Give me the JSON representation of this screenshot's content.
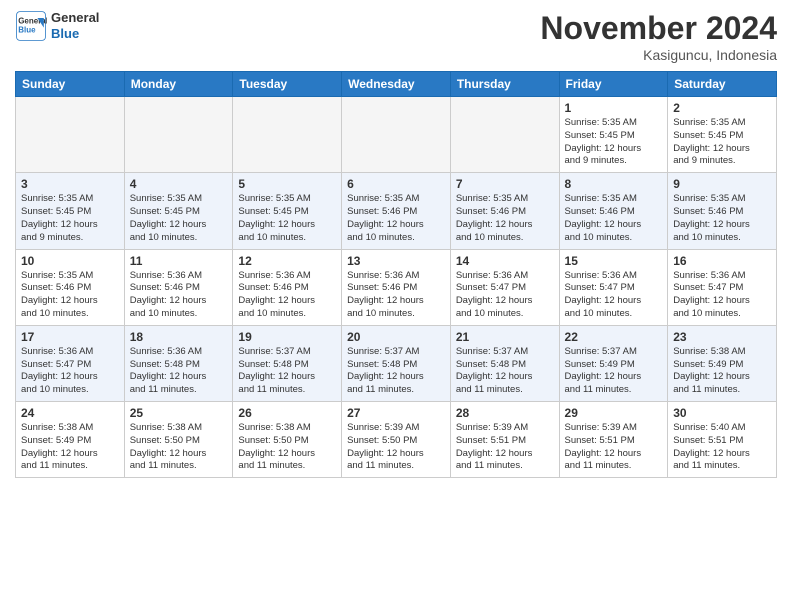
{
  "header": {
    "logo_line1": "General",
    "logo_line2": "Blue",
    "month": "November 2024",
    "location": "Kasiguncu, Indonesia"
  },
  "days_of_week": [
    "Sunday",
    "Monday",
    "Tuesday",
    "Wednesday",
    "Thursday",
    "Friday",
    "Saturday"
  ],
  "weeks": [
    [
      {
        "day": "",
        "info": ""
      },
      {
        "day": "",
        "info": ""
      },
      {
        "day": "",
        "info": ""
      },
      {
        "day": "",
        "info": ""
      },
      {
        "day": "",
        "info": ""
      },
      {
        "day": "1",
        "info": "Sunrise: 5:35 AM\nSunset: 5:45 PM\nDaylight: 12 hours\nand 9 minutes."
      },
      {
        "day": "2",
        "info": "Sunrise: 5:35 AM\nSunset: 5:45 PM\nDaylight: 12 hours\nand 9 minutes."
      }
    ],
    [
      {
        "day": "3",
        "info": "Sunrise: 5:35 AM\nSunset: 5:45 PM\nDaylight: 12 hours\nand 9 minutes."
      },
      {
        "day": "4",
        "info": "Sunrise: 5:35 AM\nSunset: 5:45 PM\nDaylight: 12 hours\nand 10 minutes."
      },
      {
        "day": "5",
        "info": "Sunrise: 5:35 AM\nSunset: 5:45 PM\nDaylight: 12 hours\nand 10 minutes."
      },
      {
        "day": "6",
        "info": "Sunrise: 5:35 AM\nSunset: 5:46 PM\nDaylight: 12 hours\nand 10 minutes."
      },
      {
        "day": "7",
        "info": "Sunrise: 5:35 AM\nSunset: 5:46 PM\nDaylight: 12 hours\nand 10 minutes."
      },
      {
        "day": "8",
        "info": "Sunrise: 5:35 AM\nSunset: 5:46 PM\nDaylight: 12 hours\nand 10 minutes."
      },
      {
        "day": "9",
        "info": "Sunrise: 5:35 AM\nSunset: 5:46 PM\nDaylight: 12 hours\nand 10 minutes."
      }
    ],
    [
      {
        "day": "10",
        "info": "Sunrise: 5:35 AM\nSunset: 5:46 PM\nDaylight: 12 hours\nand 10 minutes."
      },
      {
        "day": "11",
        "info": "Sunrise: 5:36 AM\nSunset: 5:46 PM\nDaylight: 12 hours\nand 10 minutes."
      },
      {
        "day": "12",
        "info": "Sunrise: 5:36 AM\nSunset: 5:46 PM\nDaylight: 12 hours\nand 10 minutes."
      },
      {
        "day": "13",
        "info": "Sunrise: 5:36 AM\nSunset: 5:46 PM\nDaylight: 12 hours\nand 10 minutes."
      },
      {
        "day": "14",
        "info": "Sunrise: 5:36 AM\nSunset: 5:47 PM\nDaylight: 12 hours\nand 10 minutes."
      },
      {
        "day": "15",
        "info": "Sunrise: 5:36 AM\nSunset: 5:47 PM\nDaylight: 12 hours\nand 10 minutes."
      },
      {
        "day": "16",
        "info": "Sunrise: 5:36 AM\nSunset: 5:47 PM\nDaylight: 12 hours\nand 10 minutes."
      }
    ],
    [
      {
        "day": "17",
        "info": "Sunrise: 5:36 AM\nSunset: 5:47 PM\nDaylight: 12 hours\nand 10 minutes."
      },
      {
        "day": "18",
        "info": "Sunrise: 5:36 AM\nSunset: 5:48 PM\nDaylight: 12 hours\nand 11 minutes."
      },
      {
        "day": "19",
        "info": "Sunrise: 5:37 AM\nSunset: 5:48 PM\nDaylight: 12 hours\nand 11 minutes."
      },
      {
        "day": "20",
        "info": "Sunrise: 5:37 AM\nSunset: 5:48 PM\nDaylight: 12 hours\nand 11 minutes."
      },
      {
        "day": "21",
        "info": "Sunrise: 5:37 AM\nSunset: 5:48 PM\nDaylight: 12 hours\nand 11 minutes."
      },
      {
        "day": "22",
        "info": "Sunrise: 5:37 AM\nSunset: 5:49 PM\nDaylight: 12 hours\nand 11 minutes."
      },
      {
        "day": "23",
        "info": "Sunrise: 5:38 AM\nSunset: 5:49 PM\nDaylight: 12 hours\nand 11 minutes."
      }
    ],
    [
      {
        "day": "24",
        "info": "Sunrise: 5:38 AM\nSunset: 5:49 PM\nDaylight: 12 hours\nand 11 minutes."
      },
      {
        "day": "25",
        "info": "Sunrise: 5:38 AM\nSunset: 5:50 PM\nDaylight: 12 hours\nand 11 minutes."
      },
      {
        "day": "26",
        "info": "Sunrise: 5:38 AM\nSunset: 5:50 PM\nDaylight: 12 hours\nand 11 minutes."
      },
      {
        "day": "27",
        "info": "Sunrise: 5:39 AM\nSunset: 5:50 PM\nDaylight: 12 hours\nand 11 minutes."
      },
      {
        "day": "28",
        "info": "Sunrise: 5:39 AM\nSunset: 5:51 PM\nDaylight: 12 hours\nand 11 minutes."
      },
      {
        "day": "29",
        "info": "Sunrise: 5:39 AM\nSunset: 5:51 PM\nDaylight: 12 hours\nand 11 minutes."
      },
      {
        "day": "30",
        "info": "Sunrise: 5:40 AM\nSunset: 5:51 PM\nDaylight: 12 hours\nand 11 minutes."
      }
    ]
  ]
}
